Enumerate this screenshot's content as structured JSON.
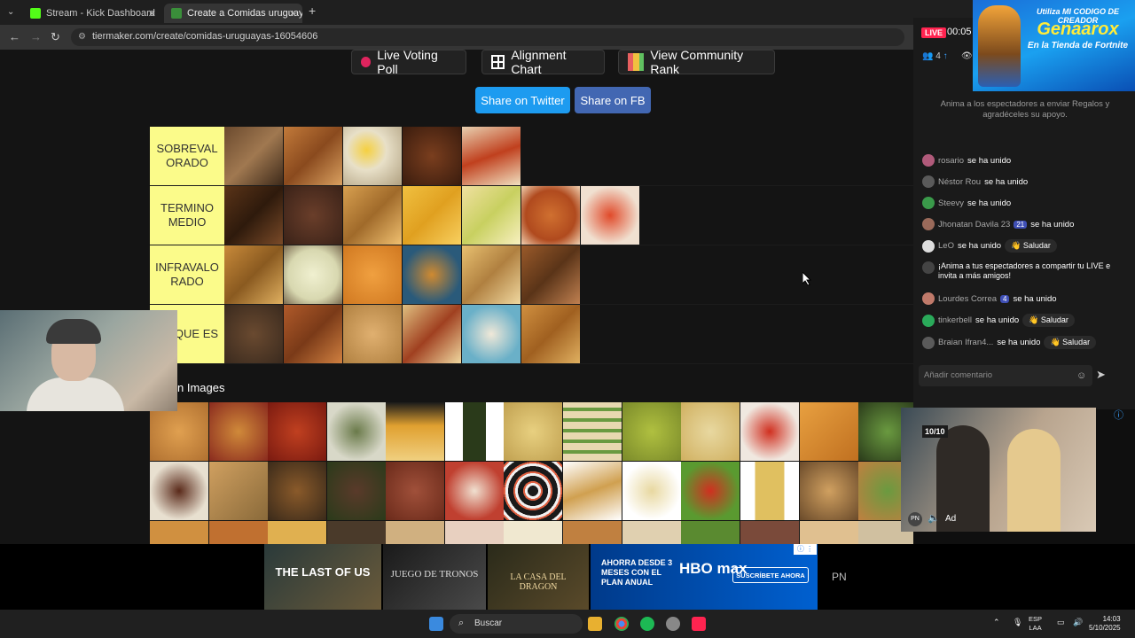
{
  "browser": {
    "tabs": [
      {
        "label": "Stream - Kick Dashboard",
        "close": "✕"
      },
      {
        "label": "Create a Comidas uruguayas Ti",
        "close": "✕"
      }
    ],
    "new_tab": "+",
    "url": "tiermaker.com/create/comidas-uruguayas-16054606"
  },
  "page": {
    "buttons": {
      "live_voting": "Live Voting Poll",
      "alignment": "Alignment Chart",
      "community": "View Community Rank",
      "share_twitter": "Share on Twitter",
      "share_fb": "Share on FB"
    },
    "colors": {
      "twitter": "#1d9bf0",
      "fb": "#4267b2",
      "tier_label": "#fbfb8a"
    },
    "tiers": [
      {
        "label": "SOBREVAL ORADO",
        "count": 5
      },
      {
        "label": "TERMINO MEDIO",
        "count": 7
      },
      {
        "label": "INFRAVALO RADO",
        "count": 6
      },
      {
        "label": "SE QUE ES",
        "count": 6
      }
    ],
    "images_label": "n Images"
  },
  "stream_panel": {
    "live": "LIVE",
    "timer": "00:05",
    "viewers": "4",
    "promo": {
      "line1": "Utiliza MI CODIGO DE CREADOR",
      "line2": "Genaarox",
      "line3": "En la Tienda de Fortnite"
    },
    "gift_note": "Anima a los espectadores a enviar Regalos y agradéceles su apoyo.",
    "chat": [
      {
        "user": "rosario",
        "text": "se ha unido"
      },
      {
        "user": "Néstor Rou",
        "text": "se ha unido"
      },
      {
        "user": "Steevy",
        "text": "se ha unido"
      },
      {
        "user": "Jhonatan Davila 23",
        "badge": "21",
        "text": "se ha unido"
      },
      {
        "user": "LeO",
        "text": "se ha unido",
        "action": "Saludar"
      },
      {
        "user": "",
        "text": "¡Anima a tus espectadores a compartir tu LIVE e invita a más amigos!"
      },
      {
        "user": "Lourdes Correa",
        "badge": "4",
        "text": "se ha unido"
      },
      {
        "user": "tinkerbell",
        "text": "se ha unido",
        "action": "Saludar"
      },
      {
        "user": "Braian Ifran4...",
        "text": "se ha unido",
        "action": "Saludar"
      }
    ],
    "comment_placeholder": "Añadir comentario"
  },
  "video_ad": {
    "score": "10/10",
    "ad": "Ad",
    "initials": "PN"
  },
  "bottom_ad": {
    "titles": [
      "THE LAST OF US",
      "JUEGO DE TRONOS",
      "LA CASA DEL DRAGON"
    ],
    "offer": "AHORRA DESDE 3 MESES CON EL PLAN ANUAL",
    "brand": "HBO max",
    "cta": "SUSCRÍBETE AHORA",
    "initials": "PN"
  },
  "taskbar": {
    "search": "Buscar",
    "lang": [
      "ESP",
      "LAA"
    ],
    "time": "14:03",
    "date": "5/10/2025"
  }
}
